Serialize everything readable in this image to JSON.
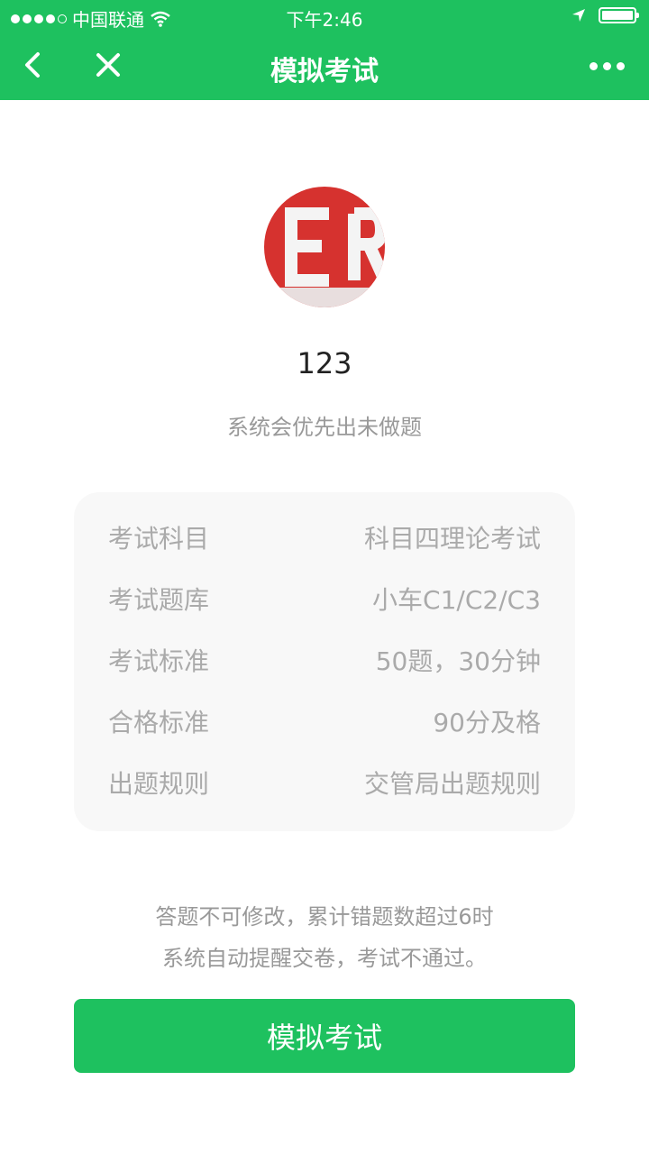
{
  "status_bar": {
    "carrier": "中国联通",
    "time": "下午2:46"
  },
  "nav": {
    "title": "模拟考试",
    "back_icon": "chevron-left-icon",
    "close_icon": "close-icon",
    "more_icon": "more-dots-icon"
  },
  "profile": {
    "name": "123",
    "hint": "系统会优先出未做题"
  },
  "info": {
    "rows": [
      {
        "label": "考试科目",
        "value": "科目四理论考试"
      },
      {
        "label": "考试题库",
        "value": "小车C1/C2/C3"
      },
      {
        "label": "考试标准",
        "value": "50题，30分钟"
      },
      {
        "label": "合格标准",
        "value": "90分及格"
      },
      {
        "label": "出题规则",
        "value": "交管局出题规则"
      }
    ]
  },
  "notice": {
    "line1": "答题不可修改，累计错题数超过6时",
    "line2": "系统自动提醒交卷，考试不通过。"
  },
  "action": {
    "start_label": "模拟考试"
  },
  "colors": {
    "accent": "#1ec15f",
    "card_bg": "#f8f8f8",
    "muted_text": "#999999"
  }
}
